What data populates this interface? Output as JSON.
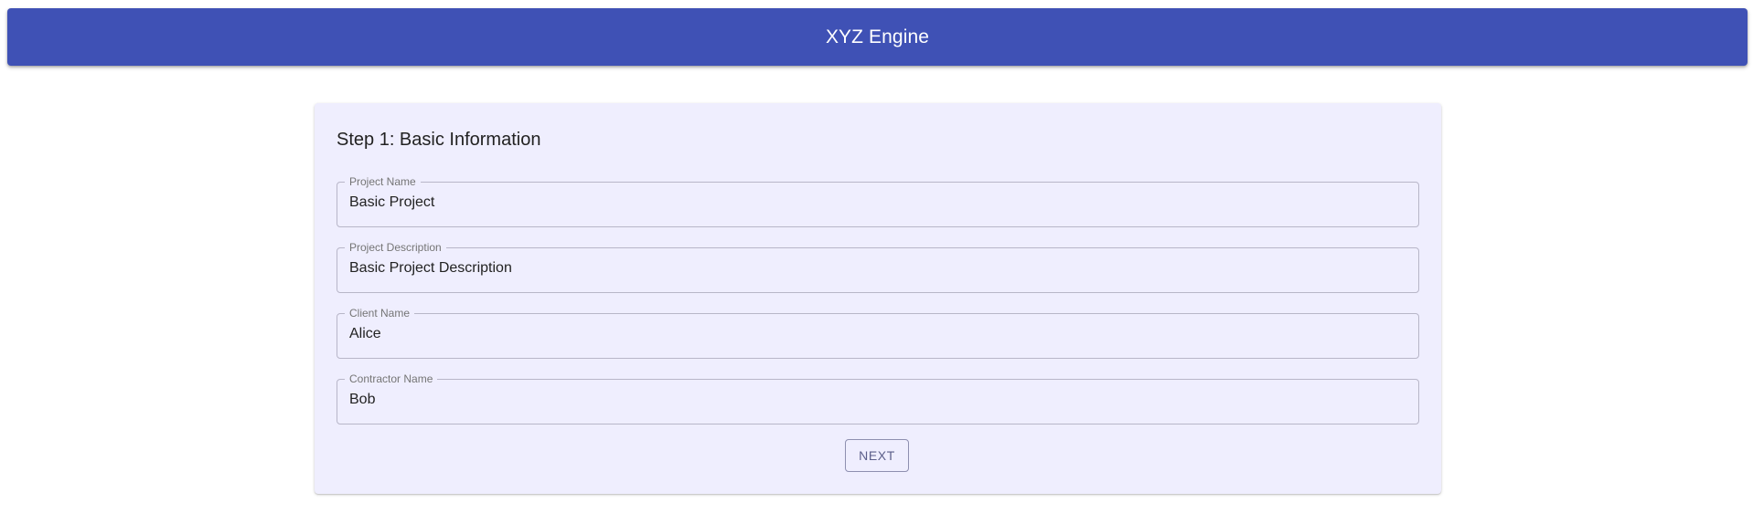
{
  "header": {
    "title": "XYZ Engine"
  },
  "step": {
    "title": "Step 1: Basic Information",
    "fields": [
      {
        "label": "Project Name",
        "value": "Basic Project"
      },
      {
        "label": "Project Description",
        "value": "Basic Project Description"
      },
      {
        "label": "Client Name",
        "value": "Alice"
      },
      {
        "label": "Contractor Name",
        "value": "Bob"
      }
    ],
    "next_label": "NEXT"
  },
  "colors": {
    "app_bar": "#3f51b5",
    "card_background": "#efeefe"
  }
}
